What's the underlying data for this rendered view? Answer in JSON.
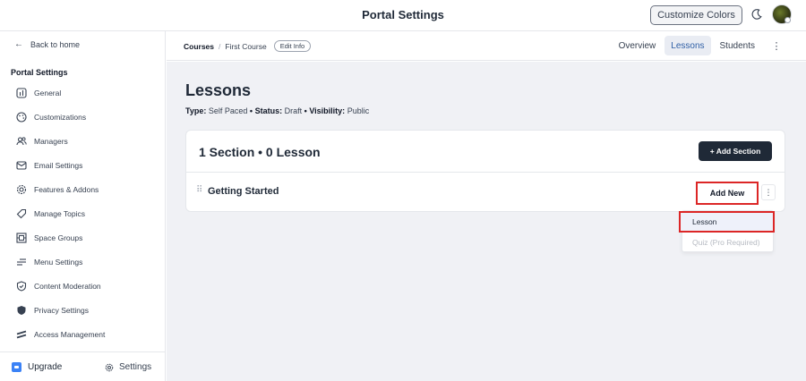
{
  "topbar": {
    "title": "Portal Settings",
    "customize_label": "Customize Colors"
  },
  "sidebar": {
    "back_label": "Back to home",
    "heading": "Portal Settings",
    "items": [
      {
        "label": "General",
        "icon": "info-square-icon"
      },
      {
        "label": "Customizations",
        "icon": "palette-icon"
      },
      {
        "label": "Managers",
        "icon": "users-icon"
      },
      {
        "label": "Email Settings",
        "icon": "mail-icon"
      },
      {
        "label": "Features & Addons",
        "icon": "gear-chip-icon"
      },
      {
        "label": "Manage Topics",
        "icon": "tag-icon"
      },
      {
        "label": "Space Groups",
        "icon": "grid-icon"
      },
      {
        "label": "Menu Settings",
        "icon": "menu-lines-icon"
      },
      {
        "label": "Content Moderation",
        "icon": "shield-check-icon"
      },
      {
        "label": "Privacy Settings",
        "icon": "shield-fill-icon"
      },
      {
        "label": "Access Management",
        "icon": "lines-slant-icon"
      }
    ],
    "footer": {
      "upgrade_label": "Upgrade",
      "settings_label": "Settings"
    }
  },
  "subbar": {
    "crumb_courses": "Courses",
    "crumb_sep": "/",
    "crumb_course": "First Course",
    "edit_info_label": "Edit Info",
    "tabs": [
      {
        "label": "Overview",
        "active": false
      },
      {
        "label": "Lessons",
        "active": true
      },
      {
        "label": "Students",
        "active": false
      }
    ],
    "more_label": "⋮"
  },
  "main": {
    "title": "Lessons",
    "meta": {
      "type_label": "Type:",
      "type_value": "Self Paced",
      "status_label": "Status:",
      "status_value": "Draft",
      "visibility_label": "Visibility:",
      "visibility_value": "Public",
      "bullet": "•"
    },
    "card": {
      "title": "1 Section • 0 Lesson",
      "add_section_label": "+ Add Section",
      "section": {
        "drag_handle": "⠿",
        "title": "Getting Started",
        "add_new_label": "Add New",
        "more_label": "⋮"
      }
    },
    "dropdown": {
      "items": [
        {
          "label": "Lesson",
          "disabled": false
        },
        {
          "label": "Quiz (Pro Required)",
          "disabled": true
        }
      ]
    }
  },
  "colors": {
    "accent": "#2f5fa6",
    "dark_button": "#1f2937",
    "highlight_red": "#dc2626",
    "main_bg": "#f0f1f5"
  }
}
